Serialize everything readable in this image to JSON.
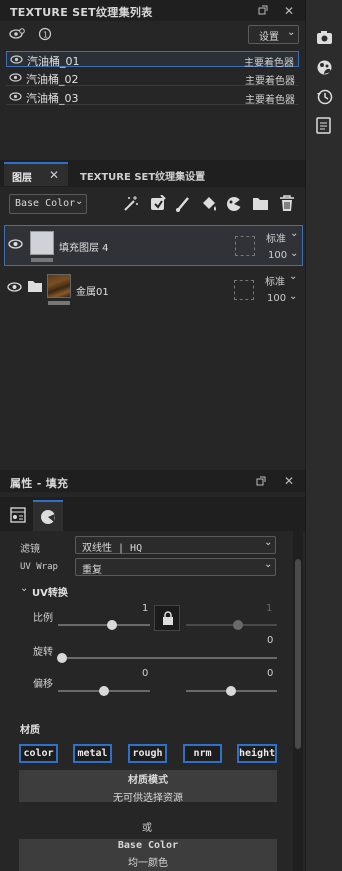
{
  "texture_set_list": {
    "title": "TEXTURE SET纹理集列表",
    "settings_label": "设置",
    "rows": [
      {
        "name": "汽油桶_01",
        "shader": "主要着色器"
      },
      {
        "name": "汽油桶_02",
        "shader": "主要着色器"
      },
      {
        "name": "汽油桶_03",
        "shader": "主要着色器"
      }
    ]
  },
  "layers_panel": {
    "tab_layers": "图层",
    "tab_settings": "TEXTURE SET纹理集设置",
    "channel_select": "Base Color",
    "layers": [
      {
        "name": "填充图层 4",
        "blend": "标准",
        "opacity": "100"
      },
      {
        "name": "金属01",
        "blend": "标准",
        "opacity": "100"
      }
    ]
  },
  "properties": {
    "title": "属性 - 填充",
    "filter_label": "滤镜",
    "filter_value": "双线性 | HQ",
    "uvwrap_label": "UV Wrap",
    "uvwrap_value": "重复",
    "uv_transform_label": "UV转换",
    "scale_label": "比例",
    "scale_value": "1",
    "scale_value2": "1",
    "rotation_label": "旋转",
    "rotation_value": "0",
    "offset_label": "偏移",
    "offset_value1": "0",
    "offset_value2": "0",
    "material_label": "材质",
    "channels": [
      "color",
      "metal",
      "rough",
      "nrm",
      "height"
    ],
    "material_mode_title": "材质模式",
    "material_mode_sub": "无可供选择资源",
    "or_label": "或",
    "base_color_title": "Base Color",
    "base_color_sub": "均一颜色"
  }
}
